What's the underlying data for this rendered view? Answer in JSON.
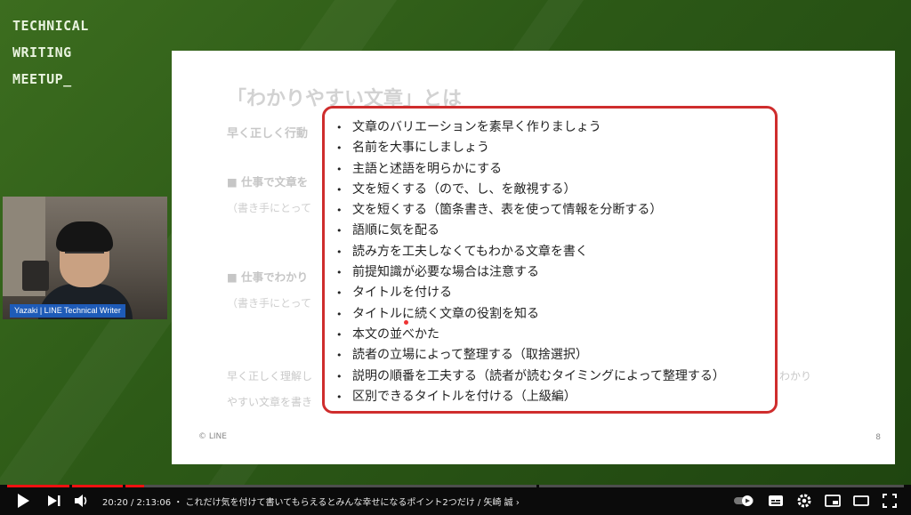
{
  "brand": {
    "lines": [
      "TECHNICAL",
      "WRITING",
      "MEETUP_"
    ]
  },
  "slide": {
    "title": "「わかりやすい文章」とは",
    "subtitle": "早く正しく行動",
    "heading1": "■ 仕事で文章を",
    "note1": "（書き手にとって",
    "heading2": "■ 仕事でわかり",
    "note2": "（書き手にとって",
    "bottom_line1": "早く正しく理解し",
    "bottom_line2": "やすい文章を書き",
    "bottom_right": "わかり",
    "copyright": "© LINE",
    "page_number": "8"
  },
  "callout": {
    "items": [
      "文章のバリエーションを素早く作りましょう",
      "名前を大事にしましょう",
      "主語と述語を明らかにする",
      "文を短くする（ので、し、を敵視する）",
      "文を短くする（箇条書き、表を使って情報を分断する）",
      "語順に気を配る",
      "読み方を工夫しなくてもわかる文章を書く",
      "前提知識が必要な場合は注意する",
      "タイトルを付ける",
      "タイトルに続く文章の役割を知る",
      "本文の並べかた",
      "読者の立場によって整理する（取捨選択）",
      "説明の順番を工夫する（読者が読むタイミングによって整理する）",
      "区別できるタイトルを付ける（上級編）"
    ],
    "accent_color": "#cf2d2d"
  },
  "webcam": {
    "name_tag": "Yazaki | LINE Technical Writer"
  },
  "player": {
    "time": "20:20 / 2:13:06",
    "separator": "・",
    "title": "これだけ気を付けて書いてもらえるとみんな幸せになるポイント2つだけ / 矢崎 誠",
    "chevron": "›",
    "progress_fraction": 0.153,
    "icons": [
      "play-icon",
      "next-icon",
      "volume-icon",
      "autoplay-toggle",
      "subtitles-icon",
      "settings-icon",
      "miniplayer-icon",
      "theater-icon",
      "fullscreen-icon"
    ]
  }
}
